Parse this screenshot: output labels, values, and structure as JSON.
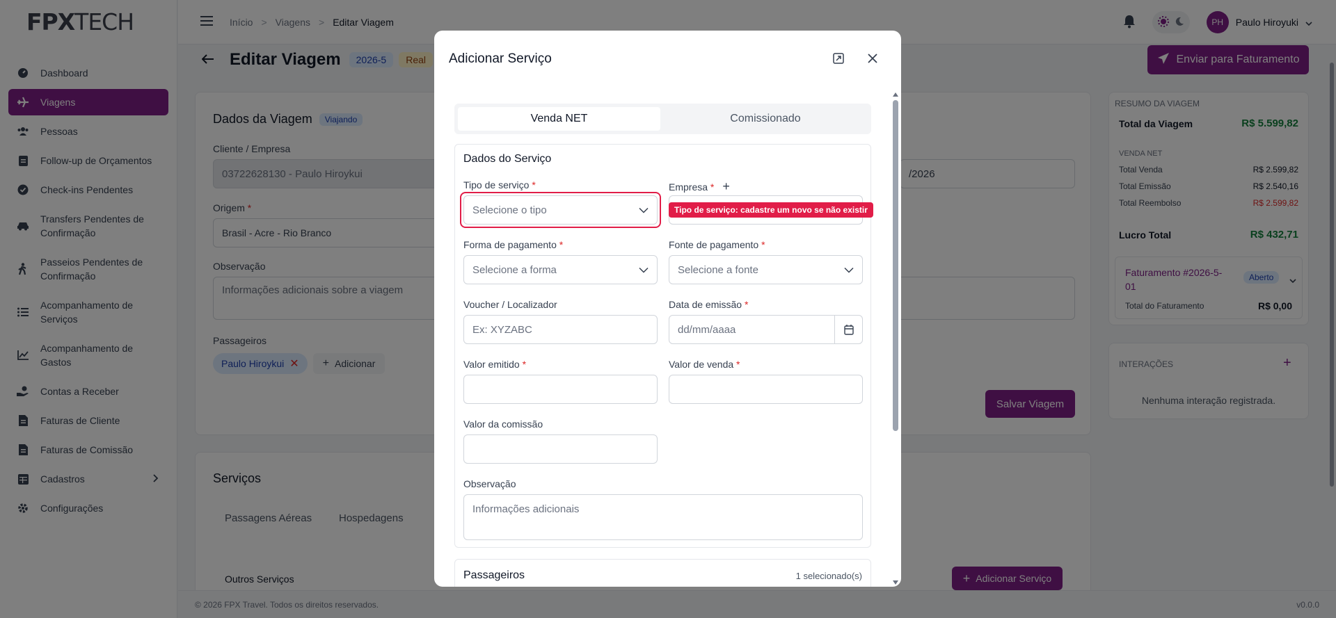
{
  "brand": {
    "logo_bold": "FPX",
    "logo_light": "TECH"
  },
  "sidebar": {
    "items": [
      {
        "label": "Dashboard"
      },
      {
        "label": "Viagens"
      },
      {
        "label": "Pessoas"
      },
      {
        "label": "Follow-up de Orçamentos"
      },
      {
        "label": "Check-ins Pendentes"
      },
      {
        "label": "Transfers Pendentes de Confirmação"
      },
      {
        "label": "Passeios Pendentes de Confirmação"
      },
      {
        "label": "Acompanhamento de Serviços"
      },
      {
        "label": "Acompanhamento de Gastos"
      },
      {
        "label": "Contas a Receber"
      },
      {
        "label": "Faturas de Cliente"
      },
      {
        "label": "Faturas de Comissão"
      },
      {
        "label": "Cadastros"
      },
      {
        "label": "Configurações"
      }
    ]
  },
  "header": {
    "breadcrumb": [
      "Início",
      "Viagens",
      "Editar Viagem"
    ],
    "user_initials": "PH",
    "user_name": "Paulo Hiroyuki"
  },
  "page": {
    "title": "Editar Viagem",
    "code_badge": "2026-5",
    "status_badge": "Real",
    "send_button": "Enviar para Faturamento",
    "trip_section": {
      "title": "Dados da Viagem",
      "status": "Viajando",
      "client_label": "Cliente / Empresa",
      "client_value": "03722628130 - Paulo Hiroykui",
      "origin_label": "Origem",
      "origin_value": "Brasil - Acre - Rio Branco",
      "date_value_fragment": "/2026",
      "obs_label": "Observação",
      "obs_placeholder": "Informações adicionais sobre a viagem",
      "passengers_label": "Passageiros",
      "passenger_chip": "Paulo Hiroykui",
      "add_label": "Adicionar",
      "save_button": "Salvar Viagem"
    },
    "services_section": {
      "title": "Serviços",
      "tabs": [
        "Passagens Aéreas",
        "Hospedagens"
      ],
      "sub_title": "Outros Serviços",
      "add_button": "Adicionar Serviço"
    },
    "summary": {
      "title": "RESUMO DA VIAGEM",
      "total_label": "Total da Viagem",
      "total_value": "R$ 5.599,82",
      "net_header": "VENDA NET",
      "rows": [
        {
          "label": "Total Venda",
          "value": "R$ 2.599,82"
        },
        {
          "label": "Total Emissão",
          "value": "R$ 2.540,16"
        },
        {
          "label": "Total Reembolso",
          "value": "R$ 2.599,82"
        }
      ],
      "profit_label": "Lucro Total",
      "profit_value": "R$ 432,71",
      "invoice_title": "Faturamento #2026-5-01",
      "invoice_status": "Aberto",
      "invoice_total_label": "Total do Faturamento",
      "invoice_total_value": "R$ 0,00"
    },
    "interactions": {
      "title": "INTERAÇÕES",
      "empty": "Nenhuma interação registrada."
    }
  },
  "footer": {
    "copyright": "© 2026 FPX Travel. Todos os direitos reservados.",
    "version": "v0.0.0"
  },
  "modal": {
    "title": "Adicionar Serviço",
    "tabs": [
      "Venda NET",
      "Comissionado"
    ],
    "section_title": "Dados do Serviço",
    "fields": {
      "tipo_label": "Tipo de serviço",
      "tipo_placeholder": "Selecione o tipo",
      "empresa_label": "Empresa",
      "forma_label": "Forma de pagamento",
      "forma_placeholder": "Selecione a forma",
      "fonte_label": "Fonte de pagamento",
      "fonte_placeholder": "Selecione a fonte",
      "voucher_label": "Voucher / Localizador",
      "voucher_placeholder": "Ex: XYZABC",
      "data_label": "Data de emissão",
      "data_placeholder": "dd/mm/aaaa",
      "valor_emitido_label": "Valor emitido",
      "valor_venda_label": "Valor de venda",
      "valor_comissao_label": "Valor da comissão",
      "obs_label": "Observação",
      "obs_placeholder": "Informações adicionais"
    },
    "error_tooltip": "Tipo de serviço: cadastre um novo se não existir",
    "passengers_title": "Passageiros",
    "passengers_count": "1 selecionado(s)"
  },
  "colors": {
    "primary": "#7e1f86",
    "error": "#e11d48",
    "success": "#15803d"
  }
}
